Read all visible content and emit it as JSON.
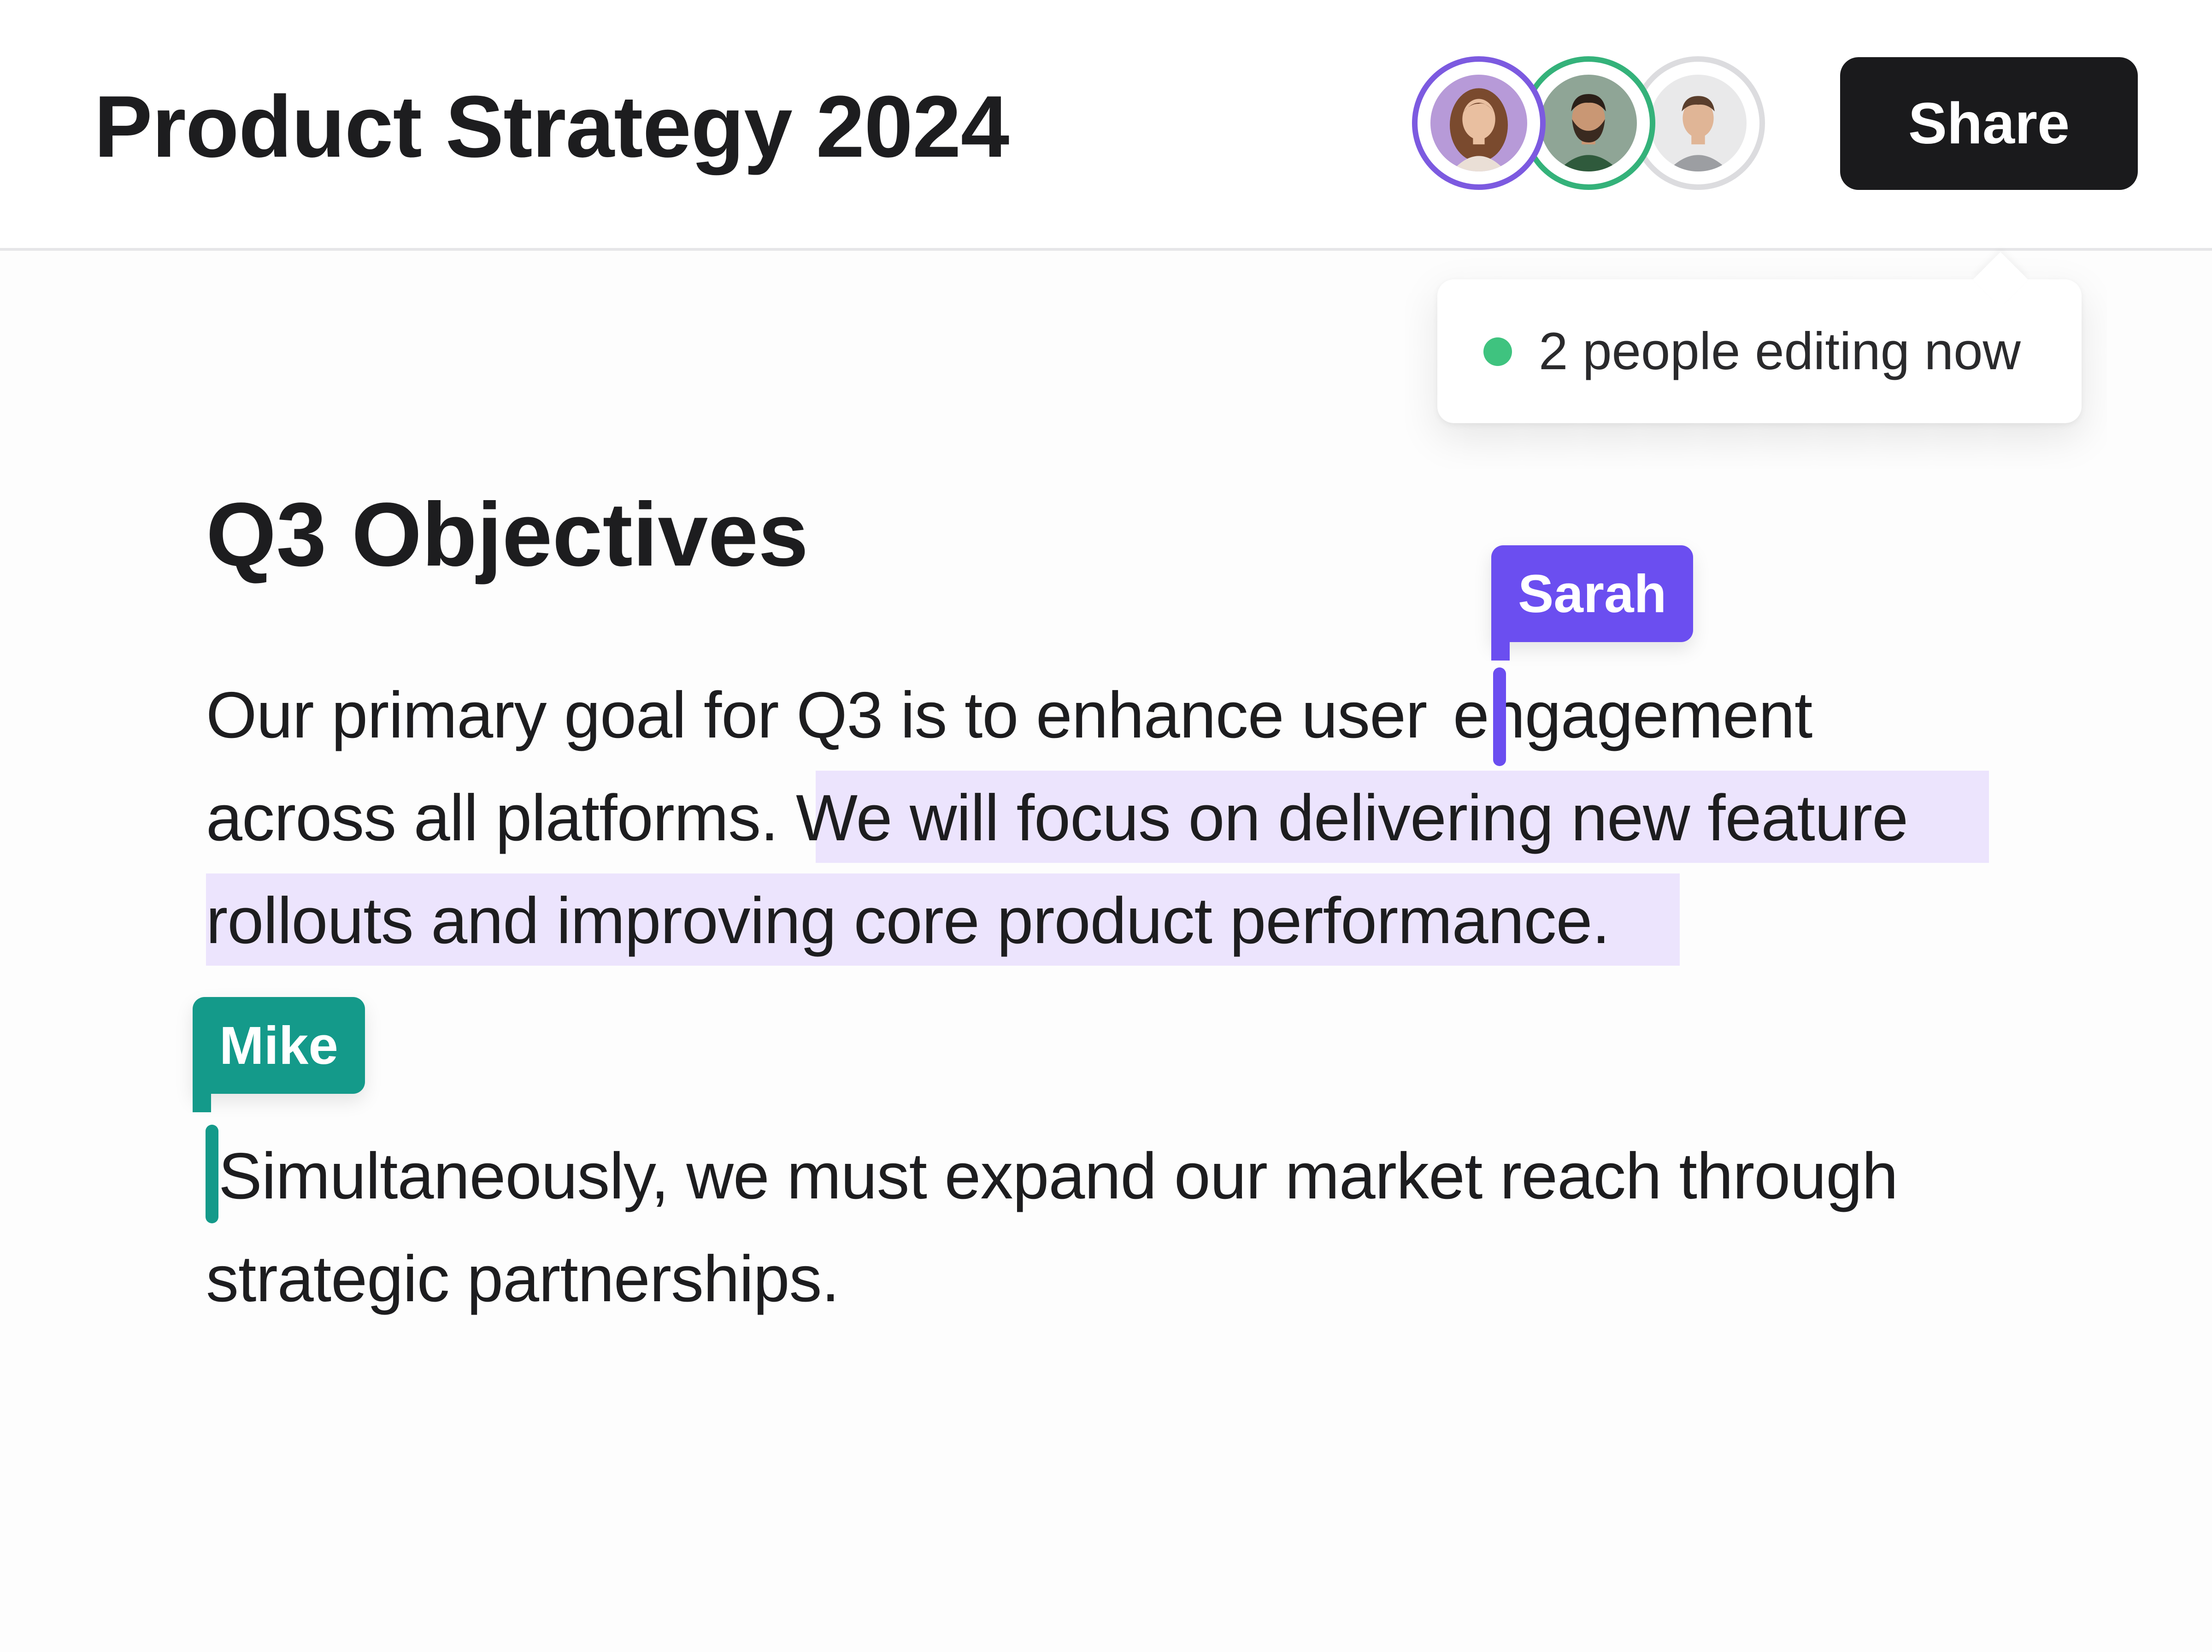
{
  "document": {
    "title": "Product Strategy 2024"
  },
  "header": {
    "collaborators": [
      {
        "icon": "avatar-woman-icon",
        "ring_color": "#7c5ae0"
      },
      {
        "icon": "avatar-bearded-man-icon",
        "ring_color": "#34b27a"
      },
      {
        "icon": "avatar-man-icon",
        "ring_color": "#dcdcdf"
      }
    ],
    "share_label": "Share"
  },
  "presence": {
    "text": "2 people editing now",
    "status_color": "#3fc37f"
  },
  "content": {
    "heading": "Q3 Objectives",
    "paragraph_1": {
      "line_1_before_cursor": "Our primary goal for Q3 is to enhance user ",
      "line_1_after_cursor": "engagement",
      "line_2_plain": "across all platforms. ",
      "line_2_selected": "We will focus on delivering new feature",
      "line_3_selected": "rollouts and improving core product performance."
    },
    "paragraph_2": {
      "line_1": "Simultaneously, we must expand our market reach through",
      "line_2": "strategic partnerships."
    }
  },
  "cursors": {
    "sarah": {
      "name": "Sarah",
      "color": "#6b4ef0"
    },
    "mike": {
      "name": "Mike",
      "color": "#149a8a"
    }
  },
  "colors": {
    "selection_highlight": "#ece4fd",
    "share_button_bg": "#1a1a1c"
  }
}
